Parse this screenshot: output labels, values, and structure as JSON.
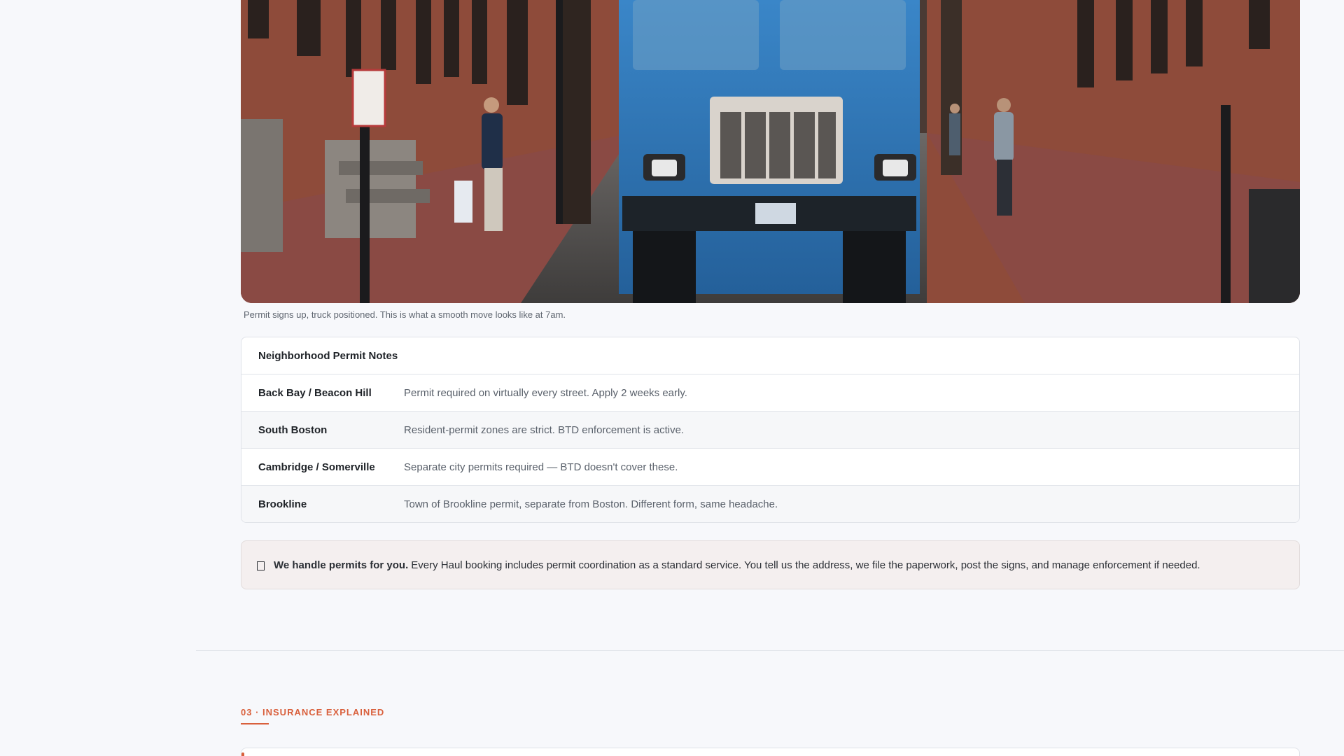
{
  "photo": {
    "alt_subject": "blue truck on a brick-lined Boston street with permit signs",
    "caption": "Permit signs up, truck positioned. This is what a smooth move looks like at 7am."
  },
  "permit_notes": {
    "title": "Neighborhood Permit Notes",
    "rows": [
      {
        "area": "Back Bay / Beacon Hill",
        "note": "Permit required on virtually every street. Apply 2 weeks early."
      },
      {
        "area": "South Boston",
        "note": "Resident-permit zones are strict. BTD enforcement is active."
      },
      {
        "area": "Cambridge / Somerville",
        "note": "Separate city permits required — BTD doesn't cover these."
      },
      {
        "area": "Brookline",
        "note": "Town of Brookline permit, separate from Boston. Different form, same headache."
      }
    ]
  },
  "callout": {
    "icon": "document-icon",
    "strong": "We handle permits for you.",
    "text": "Every Haul booking includes permit coordination as a standard service. You tell us the address, we file the paperwork, post the signs, and manage enforcement if needed."
  },
  "next_section": {
    "label": "03 · INSURANCE EXPLAINED"
  },
  "colors": {
    "accent": "#d9603c",
    "background": "#f7f8fb",
    "callout_bg": "#f4efef",
    "truck_blue": "#2f74b5"
  }
}
